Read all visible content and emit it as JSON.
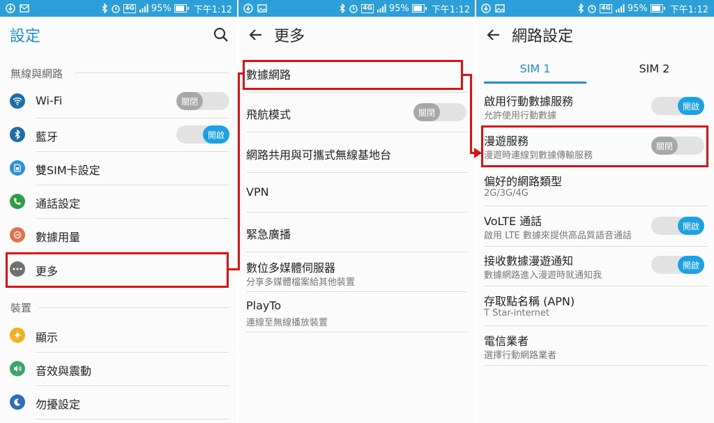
{
  "statusbar": {
    "battery": "95%",
    "time": "下午1:12",
    "network": "4G"
  },
  "panel1": {
    "title": "設定",
    "section1": "無線與網路",
    "section2": "裝置",
    "items": [
      {
        "label": "Wi-Fi",
        "toggle": "關閉",
        "toggle_state": "off",
        "icon": "wifi-icon",
        "color": "#1e6fa8"
      },
      {
        "label": "藍牙",
        "toggle": "開啟",
        "toggle_state": "on",
        "icon": "bluetooth-icon",
        "color": "#1e6fa8"
      },
      {
        "label": "雙SIM卡設定",
        "icon": "sim-icon",
        "color": "#2d8fd6"
      },
      {
        "label": "通話設定",
        "icon": "phone-icon",
        "color": "#2f9d45"
      },
      {
        "label": "數據用量",
        "icon": "data-usage-icon",
        "color": "#e2704a"
      },
      {
        "label": "更多",
        "icon": "more-icon",
        "color": "#6f6f6f"
      },
      {
        "label": "顯示",
        "icon": "display-icon",
        "color": "#f2b01f"
      },
      {
        "label": "音效與震動",
        "icon": "sound-icon",
        "color": "#3aa66c"
      },
      {
        "label": "勿擾設定",
        "icon": "moon-icon",
        "color": "#2d6fbd"
      }
    ]
  },
  "panel2": {
    "title": "更多",
    "items": [
      {
        "label": "數據網路"
      },
      {
        "label": "飛航模式",
        "toggle": "關閉",
        "toggle_state": "off"
      },
      {
        "label": "網路共用與可攜式無線基地台"
      },
      {
        "label": "VPN"
      },
      {
        "label": "緊急廣播"
      },
      {
        "label": "數位多媒體伺服器",
        "sub": "分享多媒體檔案給其他裝置"
      },
      {
        "label": "PlayTo",
        "sub": "連線至無線播放裝置"
      }
    ]
  },
  "panel3": {
    "title": "網路設定",
    "tabs": [
      "SIM 1",
      "SIM 2"
    ],
    "items": [
      {
        "label": "啟用行動數據服務",
        "sub": "允許使用行動數據",
        "toggle": "開啟",
        "toggle_state": "on"
      },
      {
        "label": "漫遊服務",
        "sub": "漫遊時連線到數據傳輸服務",
        "toggle": "關閉",
        "toggle_state": "off"
      },
      {
        "label": "偏好的網路類型",
        "sub": "2G/3G/4G"
      },
      {
        "label": "VoLTE 通話",
        "sub": "啟用 LTE 數據來提供高品質語音通話",
        "toggle": "開啟",
        "toggle_state": "on"
      },
      {
        "label": "接收數據漫遊通知",
        "sub": "數據網路進入漫遊時就通知我",
        "toggle": "開啟",
        "toggle_state": "on"
      },
      {
        "label": "存取點名稱 (APN)",
        "sub": "T Star-internet"
      },
      {
        "label": "電信業者",
        "sub": "選擇行動網路業者"
      }
    ]
  },
  "colors": {
    "statusbar": "#2c9fd9",
    "accent": "#1b8fd1",
    "toggle_on": "#1da1e6",
    "toggle_off": "#a7a7a7",
    "highlight": "#e01010"
  }
}
